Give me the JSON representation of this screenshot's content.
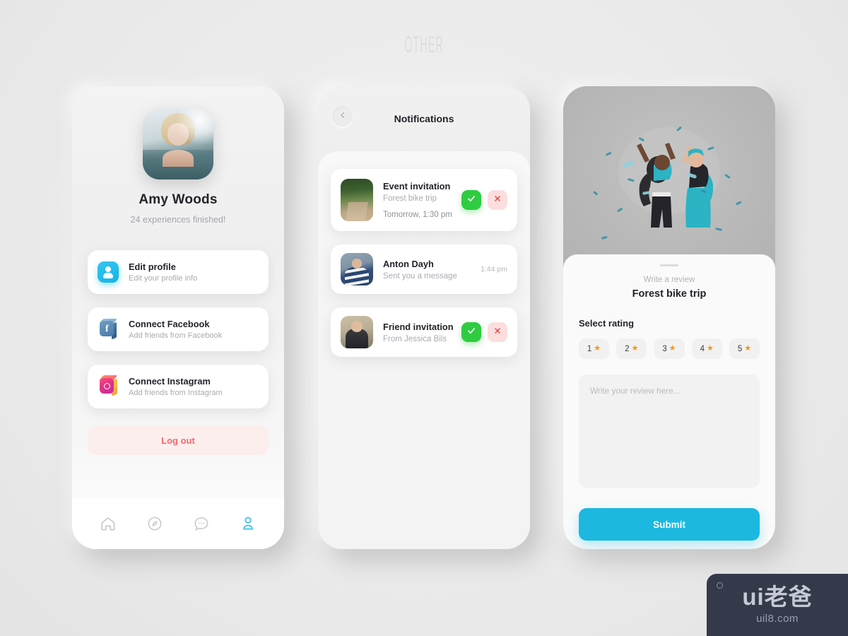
{
  "page": {
    "title": "OTHER"
  },
  "phone1": {
    "name": "profile-screen",
    "user": {
      "name": "Amy Woods",
      "subtitle": "24 experiences finished!",
      "avatar_alt": "blonde-woman-in-water"
    },
    "options": [
      {
        "icon": "user-profile-icon",
        "title": "Edit profile",
        "desc": "Edit your profile info"
      },
      {
        "icon": "facebook-icon",
        "title": "Connect Facebook",
        "desc": "Add friends from Facebook"
      },
      {
        "icon": "instagram-icon",
        "title": "Connect Instagram",
        "desc": "Add friends from Instagram"
      }
    ],
    "logout_label": "Log out",
    "logout_color": "#f26a6a",
    "logout_bg": "#fdeeee",
    "nav": [
      {
        "icon": "home-icon",
        "active": false
      },
      {
        "icon": "compass-icon",
        "active": false
      },
      {
        "icon": "chat-bubble-icon",
        "active": false
      },
      {
        "icon": "profile-icon",
        "active": true
      }
    ],
    "nav_active_color": "#3ec6ec",
    "nav_inactive_color": "#c9cbd0"
  },
  "phone2": {
    "name": "notifications-screen",
    "header": {
      "back_icon": "arrow-left-icon",
      "title": "Notifications"
    },
    "notifications": [
      {
        "thumb": "forest-trail-photo",
        "title": "Event invitation",
        "subtitle": "Forest bike trip",
        "when": "Tomorrow, 1:30 pm",
        "time": "",
        "has_actions": true
      },
      {
        "thumb": "man-striped-shirt-photo",
        "title": "Anton Dayh",
        "subtitle": "Sent you a message",
        "when": "",
        "time": "1:44 pm",
        "has_actions": false
      },
      {
        "thumb": "woman-portrait-photo",
        "title": "Friend invitation",
        "subtitle": "From Jessica Bils",
        "when": "",
        "time": "",
        "has_actions": true
      }
    ],
    "accept_icon": "check-icon",
    "reject_icon": "close-icon",
    "accept_color": "#2ecc40",
    "reject_color": "#e8483f"
  },
  "phone3": {
    "name": "write-review-screen",
    "illustration_alt": "two-people-high-five-confetti",
    "eyebrow": "Write a review",
    "trip_title": "Forest bike trip",
    "rating_label": "Select rating",
    "ratings": [
      {
        "value": "1",
        "star": "★"
      },
      {
        "value": "2",
        "star": "★"
      },
      {
        "value": "3",
        "star": "★"
      },
      {
        "value": "4",
        "star": "★"
      },
      {
        "value": "5",
        "star": "★"
      }
    ],
    "star_color": "#f5960f",
    "review_placeholder": "Write your review here...",
    "review_value": "",
    "submit_label": "Submit",
    "submit_color": "#1cb8e0"
  },
  "watermark": {
    "brand": "ui老爸",
    "url": "uil8.com"
  }
}
